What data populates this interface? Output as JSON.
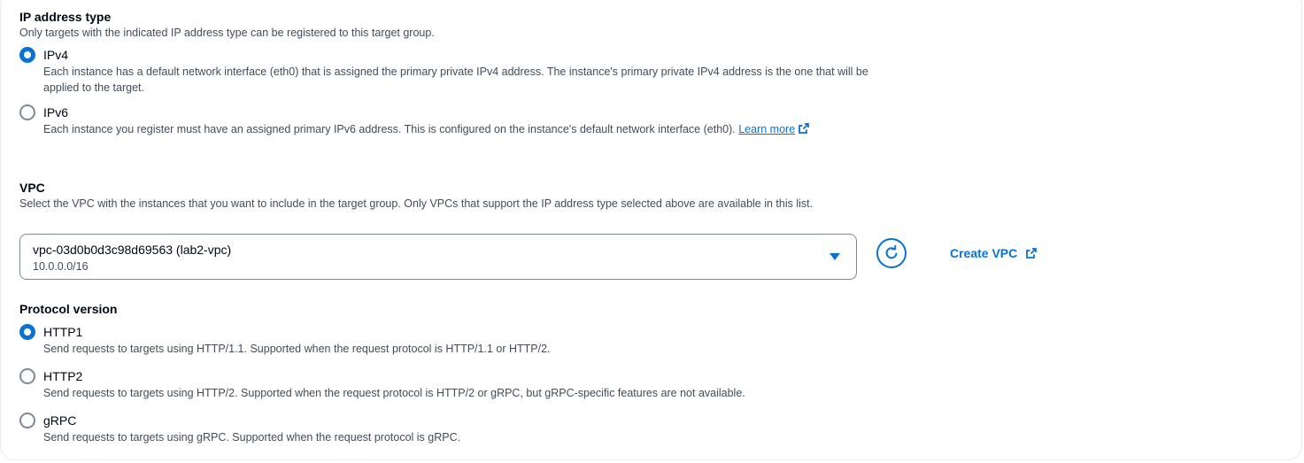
{
  "ip_section": {
    "title": "IP address type",
    "description": "Only targets with the indicated IP address type can be registered to this target group.",
    "options": [
      {
        "label": "IPv4",
        "selected": true,
        "description": "Each instance has a default network interface (eth0) that is assigned the primary private IPv4 address. The instance's primary private IPv4 address is the one that will be applied to the target."
      },
      {
        "label": "IPv6",
        "selected": false,
        "description": "Each instance you register must have an assigned primary IPv6 address. This is configured on the instance's default network interface (eth0).",
        "link_text": "Learn more"
      }
    ]
  },
  "vpc_section": {
    "title": "VPC",
    "description": "Select the VPC with the instances that you want to include in the target group. Only VPCs that support the IP address type selected above are available in this list.",
    "selected_vpc": "vpc-03d0b0d3c98d69563 (lab2-vpc)",
    "selected_cidr": "10.0.0.0/16",
    "create_label": "Create VPC"
  },
  "protocol_section": {
    "title": "Protocol version",
    "options": [
      {
        "label": "HTTP1",
        "selected": true,
        "description": "Send requests to targets using HTTP/1.1. Supported when the request protocol is HTTP/1.1 or HTTP/2."
      },
      {
        "label": "HTTP2",
        "selected": false,
        "description": "Send requests to targets using HTTP/2. Supported when the request protocol is HTTP/2 or gRPC, but gRPC-specific features are not available."
      },
      {
        "label": "gRPC",
        "selected": false,
        "description": "Send requests to targets using gRPC. Supported when the request protocol is gRPC."
      }
    ]
  },
  "colors": {
    "accent": "#0972d3",
    "text": "#000716",
    "muted": "#414d5c",
    "border": "#7d8998"
  },
  "icons": [
    "external-link-icon",
    "refresh-icon",
    "caret-down-icon"
  ]
}
